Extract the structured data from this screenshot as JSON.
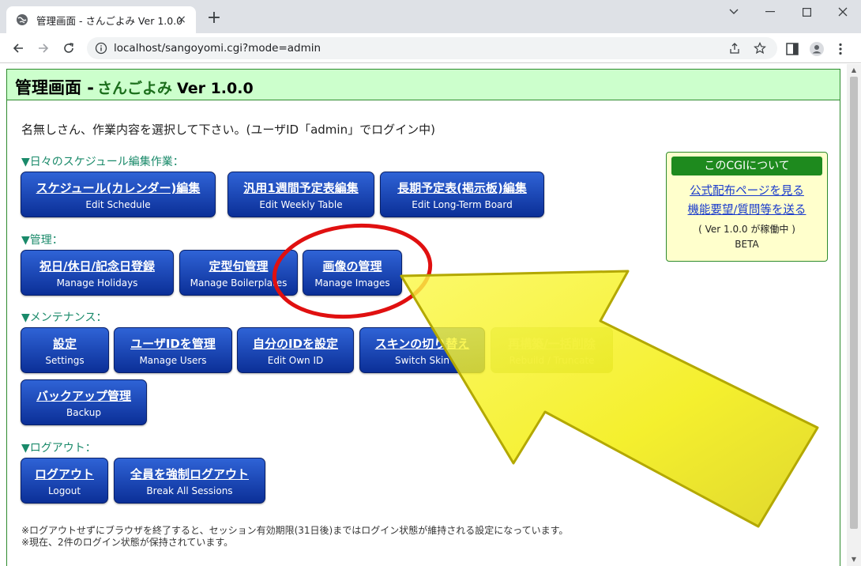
{
  "browser": {
    "tab_title": "管理画面 - さんごよみ Ver 1.0.0",
    "tab_close": "×",
    "new_tab": "+",
    "url": "localhost/sangoyomi.cgi?mode=admin"
  },
  "header": {
    "title": "管理画面 -",
    "subtitle": "さんごよみ",
    "version": "Ver 1.0.0"
  },
  "intro": "名無しさん、作業内容を選択して下さい。(ユーザID「admin」でログイン中)",
  "sections": {
    "daily": "▼日々のスケジュール編集作業：",
    "manage": "▼管理：",
    "maintenance": "▼メンテナンス：",
    "logout": "▼ログアウト："
  },
  "buttons": {
    "edit_schedule": {
      "jp": "スケジュール(カレンダー)編集",
      "en": "Edit Schedule"
    },
    "edit_weekly": {
      "jp": "汎用1週間予定表編集",
      "en": "Edit Weekly Table"
    },
    "edit_longterm": {
      "jp": "長期予定表(掲示板)編集",
      "en": "Edit Long-Term Board"
    },
    "manage_holidays": {
      "jp": "祝日/休日/記念日登録",
      "en": "Manage Holidays"
    },
    "manage_boilerplates": {
      "jp": "定型句管理",
      "en": "Manage Boilerplates"
    },
    "manage_images": {
      "jp": "画像の管理",
      "en": "Manage Images"
    },
    "settings": {
      "jp": "設定",
      "en": "Settings"
    },
    "manage_users": {
      "jp": "ユーザIDを管理",
      "en": "Manage Users"
    },
    "edit_own_id": {
      "jp": "自分のIDを設定",
      "en": "Edit Own ID"
    },
    "switch_skin": {
      "jp": "スキンの切り替え",
      "en": "Switch Skin"
    },
    "rebuild": {
      "jp": "再構築/一括削除",
      "en": "Rebuild / Truncate"
    },
    "backup": {
      "jp": "バックアップ管理",
      "en": "Backup"
    },
    "logout": {
      "jp": "ログアウト",
      "en": "Logout"
    },
    "break_sessions": {
      "jp": "全員を強制ログアウト",
      "en": "Break All Sessions"
    }
  },
  "about": {
    "title": "このCGIについて",
    "link_official": "公式配布ページを見る",
    "link_request": "機能要望/質問等を送る",
    "status": "( Ver 1.0.0 が稼働中 )",
    "beta": "BETA"
  },
  "notes": {
    "line1": "※ログアウトせずにブラウザを終了すると、セッション有効期限(31日後)まではログイン状態が維持される設定になっています。",
    "line2": "※現在、2件のログイン状態が保持されています。"
  },
  "colors": {
    "header_bg": "#ccffcc",
    "button_top": "#2f63d6",
    "button_bottom": "#0b2f97",
    "section_text": "#1a8a6a",
    "about_bg": "#ffffcc",
    "annotation_red": "#e01010",
    "annotation_yellow": "#f5f000"
  },
  "icons": {
    "favicon": "globe-icon",
    "back": "arrow-left-icon",
    "forward": "arrow-right-icon",
    "reload": "reload-icon",
    "share": "share-icon",
    "bookmark": "star-icon",
    "sidepanel": "sidepanel-icon",
    "profile": "profile-icon",
    "menu": "kebab-menu-icon"
  }
}
